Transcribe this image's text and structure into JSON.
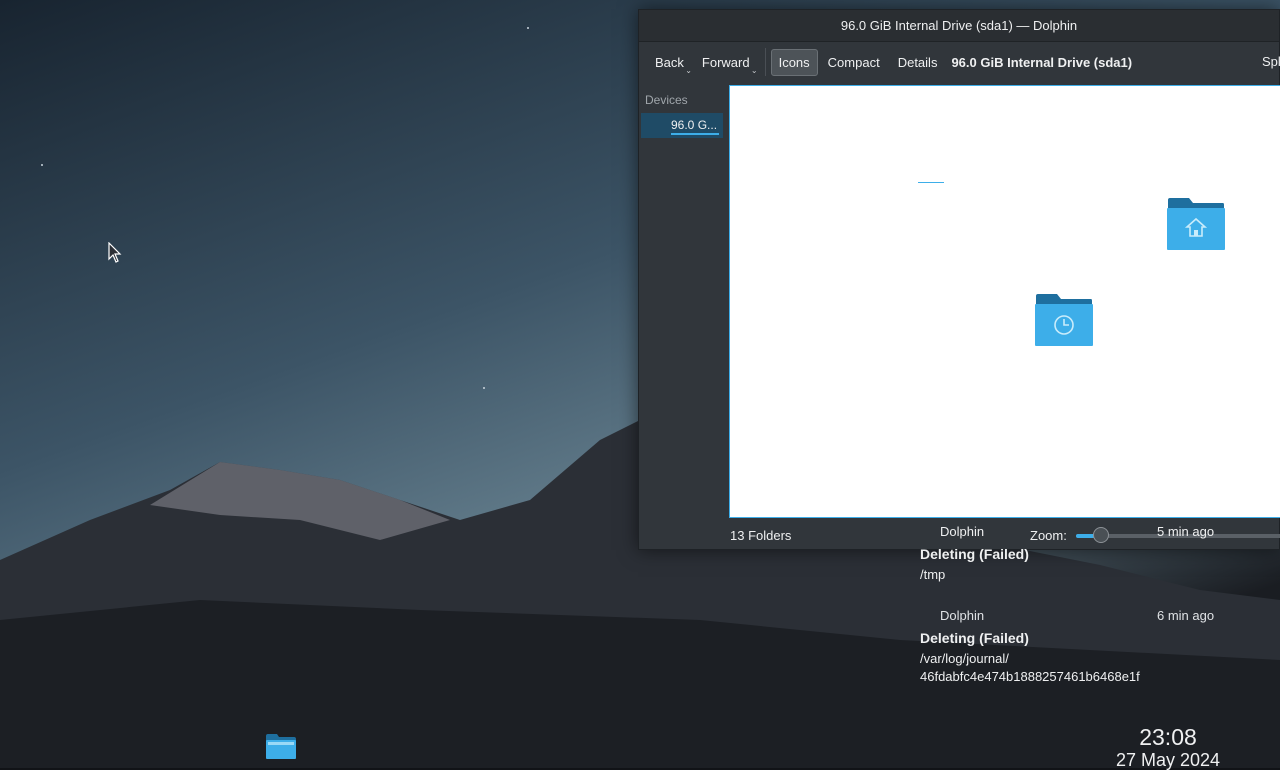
{
  "window": {
    "title": "96.0 GiB Internal Drive (sda1) — Dolphin"
  },
  "toolbar": {
    "back_label": "Back",
    "forward_label": "Forward",
    "icons_label": "Icons",
    "compact_label": "Compact",
    "details_label": "Details",
    "breadcrumb": "96.0 GiB Internal Drive (sda1)",
    "split_label": "Spl"
  },
  "sidebar": {
    "section": "Devices",
    "items": [
      {
        "label": "96.0 G...",
        "icon": "drive-icon"
      }
    ]
  },
  "view": {
    "items": [
      {
        "icon": "folder-home-icon"
      },
      {
        "icon": "folder-recent-icon"
      }
    ]
  },
  "statusbar": {
    "folders": "13 Folders",
    "zoom_label": "Zoom:",
    "zoom_level": 0.12
  },
  "notifications": [
    {
      "app": "Dolphin",
      "time": "5 min ago",
      "title": "Deleting (Failed)",
      "body": "/tmp"
    },
    {
      "app": "Dolphin",
      "time": "6 min ago",
      "title": "Deleting (Failed)",
      "body": "/var/log/journal/\n46fdabfc4e474b1888257461b6468e1f"
    }
  ],
  "taskbar": {
    "apps": [
      {
        "icon": "dolphin-icon"
      }
    ]
  },
  "clock": {
    "time": "23:08",
    "date": "27 May 2024"
  },
  "colors": {
    "accent": "#3daee9",
    "window_bg": "#31363b",
    "folder": "#3daee9"
  }
}
